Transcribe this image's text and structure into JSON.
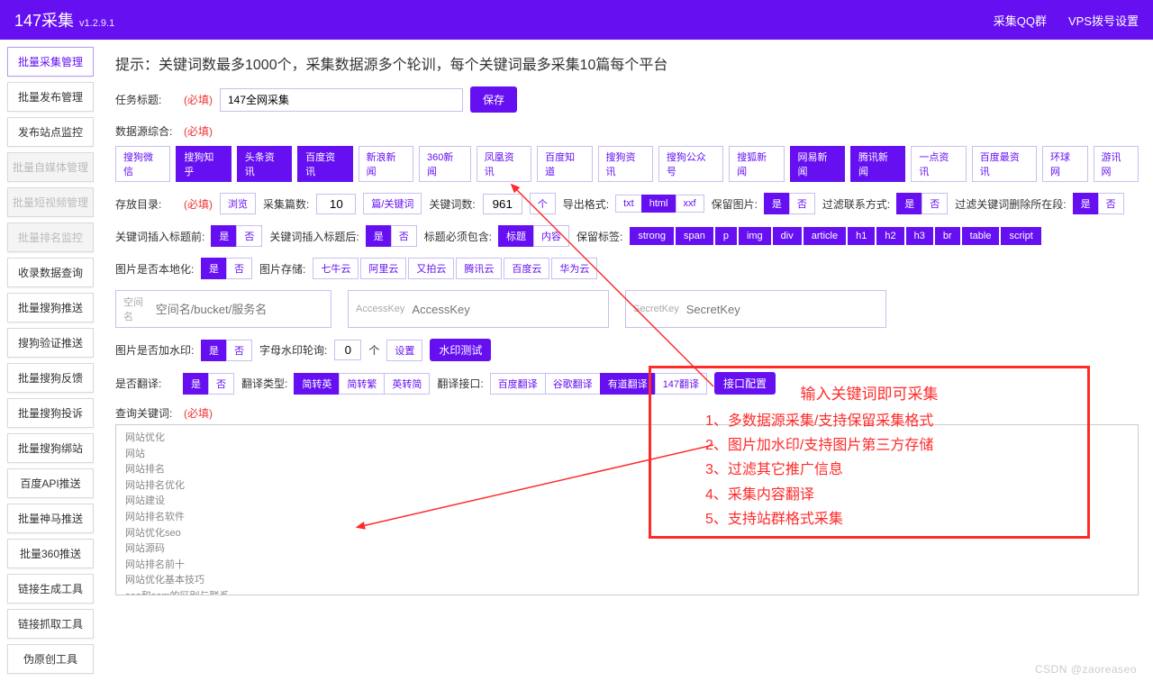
{
  "header": {
    "brand": "147采集",
    "version": "v1.2.9.1",
    "nav": [
      "采集QQ群",
      "VPS拨号设置"
    ]
  },
  "sidebar": {
    "items": [
      {
        "label": "批量采集管理",
        "mode": "active"
      },
      {
        "label": "批量发布管理"
      },
      {
        "label": "发布站点监控"
      },
      {
        "label": "批量自媒体管理",
        "mode": "dim"
      },
      {
        "label": "批量短视频管理",
        "mode": "dim"
      },
      {
        "label": "批量排名监控",
        "mode": "dim"
      },
      {
        "label": "收录数据查询"
      },
      {
        "label": "批量搜狗推送"
      },
      {
        "label": "搜狗验证推送"
      },
      {
        "label": "批量搜狗反馈"
      },
      {
        "label": "批量搜狗投诉"
      },
      {
        "label": "批量搜狗绑站"
      },
      {
        "label": "百度API推送"
      },
      {
        "label": "批量神马推送"
      },
      {
        "label": "批量360推送"
      },
      {
        "label": "链接生成工具"
      },
      {
        "label": "链接抓取工具"
      },
      {
        "label": "伪原创工具"
      }
    ]
  },
  "hint": "提示：关键词数最多1000个，采集数据源多个轮训，每个关键词最多采集10篇每个平台",
  "task": {
    "label": "任务标题:",
    "req": "(必填)",
    "value": "147全网采集",
    "save": "保存"
  },
  "sources": {
    "label": "数据源综合:",
    "req": "(必填)",
    "items": [
      {
        "t": "搜狗微信"
      },
      {
        "t": "搜狗知乎",
        "on": 1
      },
      {
        "t": "头条资讯",
        "on": 1
      },
      {
        "t": "百度资讯",
        "on": 1
      },
      {
        "t": "新浪新闻"
      },
      {
        "t": "360新闻"
      },
      {
        "t": "凤凰资讯"
      },
      {
        "t": "百度知道"
      },
      {
        "t": "搜狗资讯"
      },
      {
        "t": "搜狗公众号"
      },
      {
        "t": "搜狐新闻"
      },
      {
        "t": "网易新闻",
        "on": 1
      },
      {
        "t": "腾讯新闻",
        "on": 1
      },
      {
        "t": "一点资讯"
      },
      {
        "t": "百度最资讯"
      },
      {
        "t": "环球网"
      },
      {
        "t": "游讯网"
      }
    ]
  },
  "store": {
    "label": "存放目录:",
    "req": "(必填)",
    "browse": "浏览",
    "count_lbl": "采集篇数:",
    "count": "10",
    "count_unit": "篇/关键词",
    "kw_lbl": "关键词数:",
    "kw": "961",
    "kw_unit": "个",
    "fmt_lbl": "导出格式:",
    "fmt": [
      {
        "t": "txt"
      },
      {
        "t": "html",
        "on": 1
      },
      {
        "t": "xxf"
      }
    ],
    "keepimg_lbl": "保留图片:",
    "yn": {
      "yes": "是",
      "no": "否"
    },
    "filter_lbl": "过滤联系方式:",
    "delpos_lbl": "过滤关键词删除所在段:"
  },
  "titleins": {
    "pre_lbl": "关键词插入标题前:",
    "suf_lbl": "关键词插入标题后:",
    "must_lbl": "标题必须包含:",
    "must_opts": [
      {
        "t": "标题",
        "on": 1
      },
      {
        "t": "内容"
      }
    ],
    "tags_lbl": "保留标签:",
    "tags": [
      "strong",
      "span",
      "p",
      "img",
      "div",
      "article",
      "h1",
      "h2",
      "h3",
      "br",
      "table",
      "script"
    ]
  },
  "img": {
    "local_lbl": "图片是否本地化:",
    "store_lbl": "图片存储:",
    "stores": [
      "七牛云",
      "阿里云",
      "又拍云",
      "腾讯云",
      "百度云",
      "华为云"
    ],
    "f1": {
      "lab": "空间名",
      "ph": "空间名/bucket/服务名"
    },
    "f2": {
      "lab": "AccessKey",
      "ph": "AccessKey"
    },
    "f3": {
      "lab": "SecretKey",
      "ph": "SecretKey"
    }
  },
  "wm": {
    "lbl": "图片是否加水印:",
    "rot_lbl": "字母水印轮询:",
    "rot": "0",
    "unit": "个",
    "set": "设置",
    "test": "水印测试"
  },
  "trans": {
    "lbl": "是否翻译:",
    "type_lbl": "翻译类型:",
    "types": [
      {
        "t": "简转英",
        "on": 1
      },
      {
        "t": "简转繁"
      },
      {
        "t": "英转简"
      }
    ],
    "api_lbl": "翻译接口:",
    "apis": [
      {
        "t": "百度翻译"
      },
      {
        "t": "谷歌翻译"
      },
      {
        "t": "有道翻译",
        "on": 1
      },
      {
        "t": "147翻译"
      }
    ],
    "cfg": "接口配置"
  },
  "kw": {
    "lbl": "查询关键词:",
    "req": "(必填)",
    "text": "网站优化\n网站\n网站排名\n网站排名优化\n网站建设\n网站排名软件\n网站优化seo\n网站源码\n网站排名前十\n网站优化基本技巧\nseo和sem的区别与联系\n网站推理\n网站排名查询\n网站优化培训\nseo是什么意思"
  },
  "overlay": {
    "title": "输入关键词即可采集",
    "lines": [
      "1、多数据源采集/支持保留采集格式",
      "2、图片加水印/支持图片第三方存储",
      "3、过滤其它推广信息",
      "4、采集内容翻译",
      "5、支持站群格式采集"
    ]
  },
  "watermark": "CSDN @zaoreaseo"
}
